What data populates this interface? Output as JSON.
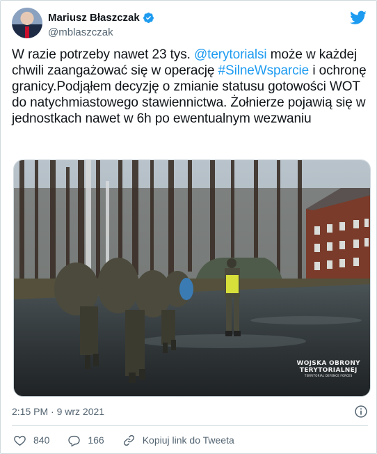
{
  "author": {
    "display_name": "Mariusz Błaszczak",
    "handle": "@mblaszczak",
    "verified_icon": "verified-badge-icon",
    "avatar_icon": "profile-photo"
  },
  "brand": {
    "logo_icon": "twitter-bird-icon",
    "accent_color": "#1d9bf0"
  },
  "tweet": {
    "text_part1": "W razie potrzeby nawet 23 tys. ",
    "mention": "@terytorialsi",
    "text_part2": " może w każdej chwili zaangażować się w operację ",
    "hashtag": "#SilneWsparcie",
    "text_part3": " i ochronę granicy.Podjąłem decyzję o zmianie statusu gotowości WOT do natychmiastowego stawiennictwa. Żołnierze pojawią się w jednostkach nawet w 6h po ewentualnym wezwaniu"
  },
  "media": {
    "watermark_line1": "WOJSKA OBRONY",
    "watermark_line2": "TERYTORIALNEJ",
    "watermark_line3": "TERRITORIAL DEFENCE FORCES"
  },
  "meta": {
    "timestamp": "2:15 PM · 9 wrz 2021",
    "info_icon": "info-icon"
  },
  "actions": {
    "likes": "840",
    "replies": "166",
    "copy_link_label": "Kopiuj link do Tweeta"
  }
}
